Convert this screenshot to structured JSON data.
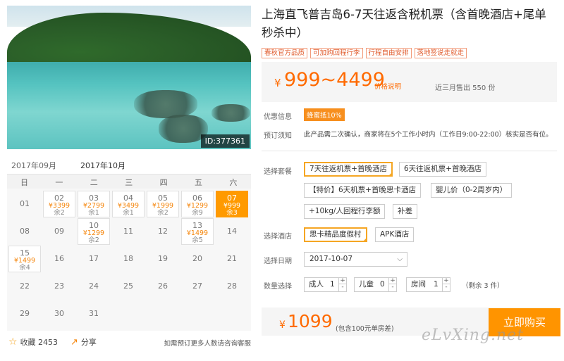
{
  "product": {
    "title": "上海直飞普吉岛6-7天往返含税机票（含首晚酒店+尾单秒杀中）",
    "image_id": "ID:377361",
    "tags": [
      "春秋官方品质",
      "可加购回程行李",
      "行程自由安排",
      "落地签说走就走"
    ],
    "price_currency": "¥",
    "price_range": "999~4499",
    "price_note_link": "价格说明",
    "sold": "近三月售出 550 份",
    "promo_label": "优惠信息",
    "promo_badge": "蜂蜜抵10%",
    "notice_label": "预订须知",
    "notice_text": "此产品需二次确认，商家将在5个工作小时内（工作日9:00-22:00）核实是否有位。"
  },
  "calendar": {
    "tabs": [
      "2017年09月",
      "2017年10月"
    ],
    "weekdays": [
      "日",
      "一",
      "二",
      "三",
      "四",
      "五",
      "六"
    ],
    "cells": [
      {
        "d": "01"
      },
      {
        "d": "02",
        "p": "¥3399",
        "r": "余2"
      },
      {
        "d": "03",
        "p": "¥2799",
        "r": "余1"
      },
      {
        "d": "04",
        "p": "¥3499",
        "r": "余1"
      },
      {
        "d": "05",
        "p": "¥1999",
        "r": "余2"
      },
      {
        "d": "06",
        "p": "¥1299",
        "r": "余9"
      },
      {
        "d": "07",
        "p": "¥999",
        "r": "余3",
        "sel": true
      },
      {
        "d": "08"
      },
      {
        "d": "09"
      },
      {
        "d": "10",
        "p": "¥1299",
        "r": "余2"
      },
      {
        "d": "11"
      },
      {
        "d": "12"
      },
      {
        "d": "13",
        "p": "¥1499",
        "r": "余5"
      },
      {
        "d": "14"
      },
      {
        "d": "15",
        "p": "¥1499",
        "r": "余4"
      },
      {
        "d": "16"
      },
      {
        "d": "17"
      },
      {
        "d": "18"
      },
      {
        "d": "19"
      },
      {
        "d": "20"
      },
      {
        "d": "21"
      },
      {
        "d": "22"
      },
      {
        "d": "23"
      },
      {
        "d": "24"
      },
      {
        "d": "25"
      },
      {
        "d": "26"
      },
      {
        "d": "27"
      },
      {
        "d": "28"
      },
      {
        "d": "29"
      },
      {
        "d": "30"
      },
      {
        "d": "31"
      }
    ]
  },
  "footer": {
    "fav": "收藏 2453",
    "share": "分享",
    "tip": "如需预订更多人数请咨询客服"
  },
  "booking": {
    "package_label": "选择套餐",
    "packages": [
      "7天往返机票+首晚酒店",
      "6天往返机票+首晚酒店",
      "【特价】6天机票+首晚思卡酒店",
      "婴儿价（0-2周岁内）",
      "+10kg/人回程行李额",
      "补差"
    ],
    "hotel_label": "选择酒店",
    "hotels": [
      "思卡精品度假村",
      "APK酒店"
    ],
    "date_label": "选择日期",
    "date_value": "2017-10-07",
    "qty_label": "数量选择",
    "adult_label": "成人",
    "adult_value": "1",
    "child_label": "儿童",
    "child_value": "0",
    "room_label": "房间",
    "room_value": "1",
    "remain": "（剩余 3 件）",
    "total_currency": "¥",
    "total": "1099",
    "total_note": "(包含100元单房差)",
    "buy_label": "立即购买"
  },
  "watermark": "eLvXing.net",
  "colors": {
    "accent": "#ff9400",
    "price": "#ff6a00"
  }
}
